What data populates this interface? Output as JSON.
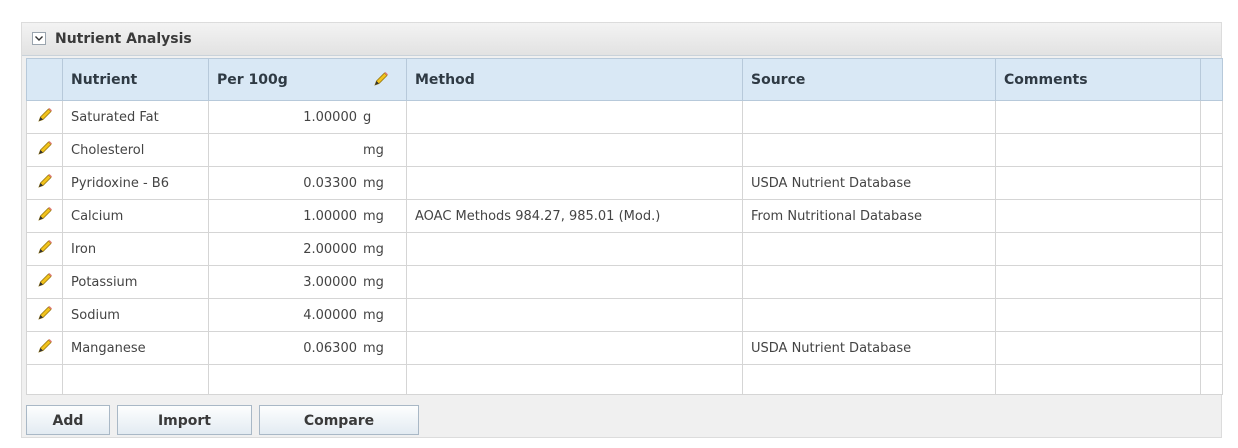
{
  "panel": {
    "title": "Nutrient Analysis",
    "collapse_icon": "chevron-down-icon"
  },
  "table": {
    "columns": [
      "Nutrient",
      "Per 100g",
      "Method",
      "Source",
      "Comments"
    ],
    "header_edit_icon": "pencil-icon",
    "row_edit_icon": "pencil-icon",
    "rows": [
      {
        "nutrient": "Saturated Fat",
        "amount": "1.00000",
        "unit": "g",
        "method": "",
        "source": "",
        "comments": ""
      },
      {
        "nutrient": "Cholesterol",
        "amount": "",
        "unit": "mg",
        "method": "",
        "source": "",
        "comments": ""
      },
      {
        "nutrient": "Pyridoxine - B6",
        "amount": "0.03300",
        "unit": "mg",
        "method": "",
        "source": "USDA Nutrient Database",
        "comments": ""
      },
      {
        "nutrient": "Calcium",
        "amount": "1.00000",
        "unit": "mg",
        "method": "AOAC Methods 984.27, 985.01 (Mod.)",
        "source": "From Nutritional Database",
        "comments": ""
      },
      {
        "nutrient": "Iron",
        "amount": "2.00000",
        "unit": "mg",
        "method": "",
        "source": "",
        "comments": ""
      },
      {
        "nutrient": "Potassium",
        "amount": "3.00000",
        "unit": "mg",
        "method": "",
        "source": "",
        "comments": ""
      },
      {
        "nutrient": "Sodium",
        "amount": "4.00000",
        "unit": "mg",
        "method": "",
        "source": "",
        "comments": ""
      },
      {
        "nutrient": "Manganese",
        "amount": "0.06300",
        "unit": "mg",
        "method": "",
        "source": "USDA Nutrient Database",
        "comments": ""
      }
    ]
  },
  "buttons": {
    "add": "Add",
    "import": "Import",
    "compare": "Compare"
  }
}
